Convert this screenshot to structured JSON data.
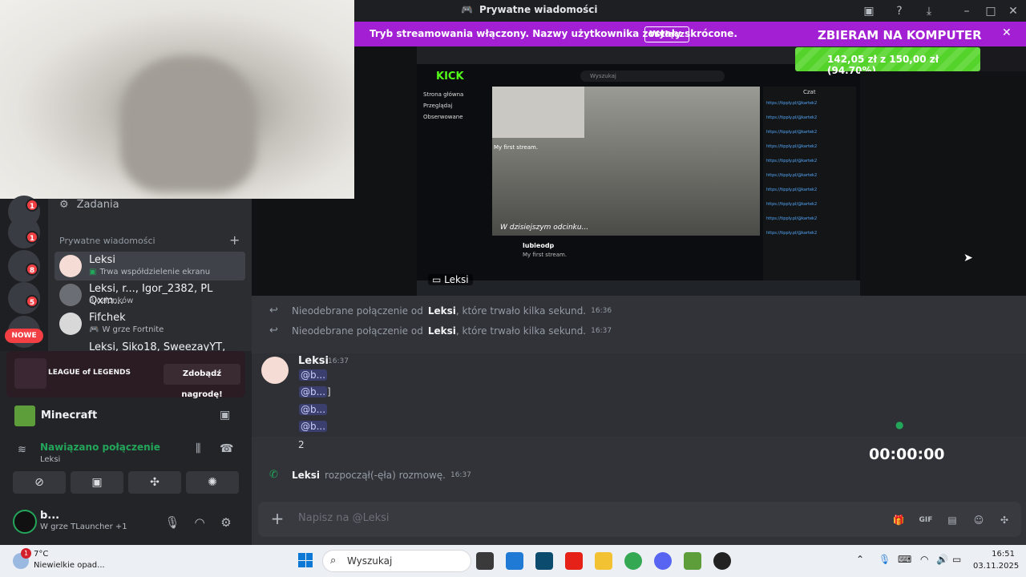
{
  "window": {
    "title": "Prywatne wiadomości"
  },
  "stream_banner": {
    "message": "Tryb streamowania włączony. Nazwy użytkownika zostały skrócone.",
    "button": "Wyłącz"
  },
  "donation": {
    "title": "ZBIERAM NA KOMPUTER",
    "progress_text": "142,05 zł z 150,00 zł (94.70%)",
    "progress_fraction": 0.947
  },
  "rail": {
    "badges": [
      "1",
      "1",
      "8",
      "5"
    ],
    "new_label": "NOWE"
  },
  "sidebar": {
    "tasks_label": "Zadania",
    "dm_header": "Prywatne wiadomości",
    "dms": [
      {
        "name": "Leksi",
        "status": "Trwa współdzielenie ekranu"
      },
      {
        "name": "Leksi, r..., Igor_2382, PL Qxm...",
        "status": "8 członków"
      },
      {
        "name": "Fifchek",
        "status": "W grze Fortnite"
      },
      {
        "name": "Leksi, Siko18, SweezayYT, fozi...",
        "status": ""
      }
    ]
  },
  "activity": {
    "game_logo": "LEAGUE of LEGENDS",
    "claim_button": "Zdobądź nagrodę!"
  },
  "game": {
    "name": "Minecraft"
  },
  "voice": {
    "status": "Nawiązano połączenie",
    "channel": "Leksi"
  },
  "user": {
    "name": "b...",
    "status": "W grze TLauncher +1"
  },
  "shared_screen": {
    "label": "Leksi",
    "site_logo": "KICK",
    "search": "Wyszukaj",
    "nav": [
      "Strona główna",
      "Przeglądaj",
      "Obserwowane"
    ],
    "video_caption": "My first stream.",
    "video_subtitle": "W dzisiejszym odcinku...",
    "streamer": "lubieodp",
    "stream_title": "My first stream.",
    "chat_header": "Czat",
    "chat_line": "https://tipply.pl/@kartek2"
  },
  "chat": {
    "system_messages": [
      {
        "prefix": "Nieodebrane połączenie od",
        "name": "Leksi",
        "suffix": ", które trwało kilka sekund.",
        "time": "16:36"
      },
      {
        "prefix": "Nieodebrane połączenie od",
        "name": "Leksi",
        "suffix": ", które trwało kilka sekund.",
        "time": "16:37"
      }
    ],
    "message_group": {
      "author": "Leksi",
      "time": "16:37",
      "lines": [
        "@b...",
        "@b...",
        "@b...",
        "@b..."
      ],
      "bracket": "]",
      "last_line": "2"
    },
    "call_started": {
      "name": "Leksi",
      "text": "rozpoczął(-ęła) rozmowę.",
      "time": "16:37"
    },
    "timer": "00:00:00",
    "composer_placeholder": "Napisz na @Leksi"
  },
  "taskbar": {
    "temperature": "7°C",
    "weather": "Niewielkie opad...",
    "weather_badge": "1",
    "search": "Wyszukaj",
    "time": "16:51",
    "date": "03.11.2025"
  }
}
